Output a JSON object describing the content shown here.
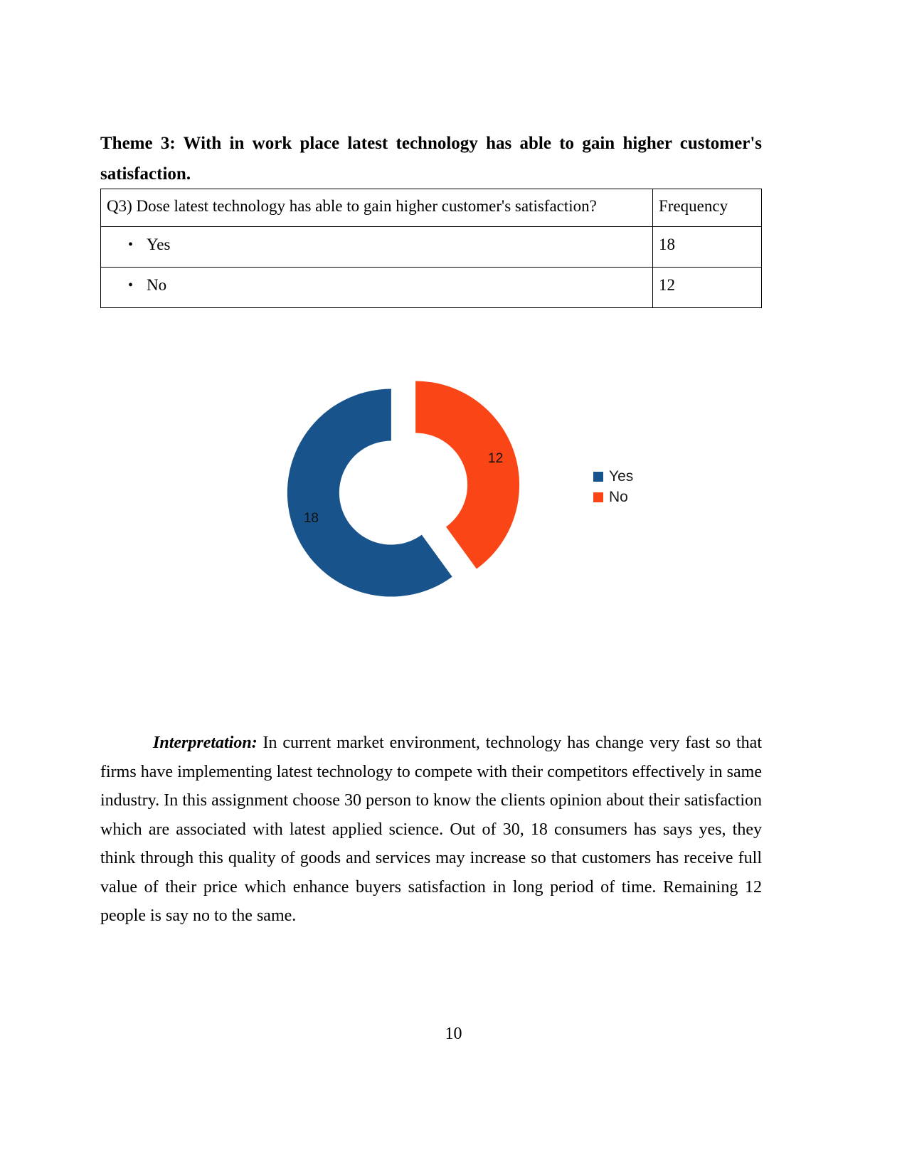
{
  "document": {
    "heading": "Theme 3: With in work place latest technology has able to gain higher customer's satisfaction.",
    "page_number": "10"
  },
  "table": {
    "header": {
      "question": "Q3) Dose latest technology has able to gain higher customer's satisfaction?",
      "frequency": "Frequency"
    },
    "bullet_glyph": "•",
    "rows": [
      {
        "label": "Yes",
        "frequency": "18"
      },
      {
        "label": "No",
        "frequency": "12"
      }
    ]
  },
  "chart_data": {
    "type": "pie",
    "variant": "exploded-doughnut",
    "title": "",
    "categories": [
      "Yes",
      "No"
    ],
    "values": [
      18,
      12
    ],
    "total": 30,
    "data_labels": [
      "18",
      "12"
    ],
    "colors": [
      "#18538C",
      "#FA4616"
    ],
    "legend": {
      "position": "right",
      "entries": [
        {
          "label": "Yes",
          "color": "#18538C"
        },
        {
          "label": "No",
          "color": "#FA4616"
        }
      ]
    },
    "angles_deg": [
      216,
      144
    ],
    "start_angle_deg": 0,
    "hole_ratio": 0.5,
    "explode": true,
    "grid": false
  },
  "interpretation": {
    "lead": "Interpretation:",
    "body": " In current market environment, technology has change very fast so that firms  have implementing latest technology to compete with their competitors effectively in same industry. In this assignment choose 30 person to know the clients opinion about their satisfaction which are associated with latest applied science. Out of 30, 18 consumers has says yes, they think through this quality of goods and services may increase so that customers has receive full value of their price which enhance buyers satisfaction in long period of time. Remaining 12 people is say no to the same."
  }
}
